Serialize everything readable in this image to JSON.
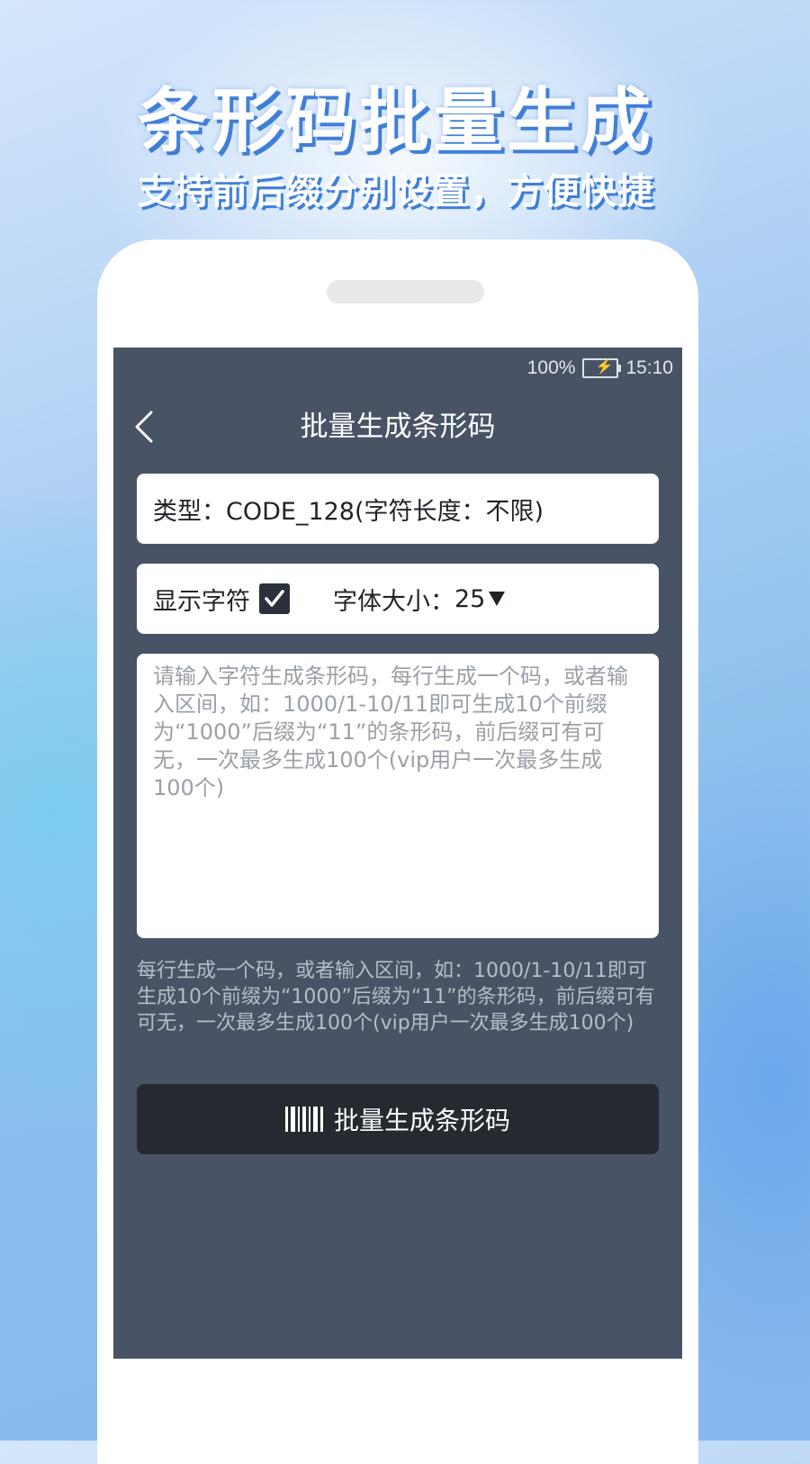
{
  "promo": {
    "title": "条形码批量生成",
    "subtitle": "支持前后缀分别设置，方便快捷"
  },
  "status_bar": {
    "battery_percent": "100%",
    "battery_level": 1.0,
    "battery_icon": "battery-charging-icon",
    "time": "15:10"
  },
  "nav": {
    "back_icon": "chevron-left-icon",
    "title": "批量生成条形码"
  },
  "type_card": {
    "text": "类型：CODE_128(字符长度：不限)"
  },
  "options": {
    "show_chars_label": "显示字符",
    "show_chars_checked": true,
    "font_size_label": "字体大小：",
    "font_size_value": "25"
  },
  "input": {
    "value": "",
    "placeholder": "请输入字符生成条形码，每行生成一个码，或者输入区间，如：1000/1-10/11即可生成10个前缀为“1000”后缀为“11”的条形码，前后缀可有可无，一次最多生成100个(vip用户一次最多生成100个)"
  },
  "hint": {
    "text": "每行生成一个码，或者输入区间，如：1000/1-10/11即可生成10个前缀为“1000”后缀为“11”的条形码，前后缀可有可无，一次最多生成100个(vip用户一次最多生成100个)"
  },
  "generate_button": {
    "icon": "barcode-icon",
    "label": "批量生成条形码"
  },
  "colors": {
    "screen_bg": "#485465",
    "button_bg": "#252a31",
    "card_bg": "#ffffff",
    "accent_shadow": "#3f7fd8",
    "battery_green": "#5cc93a"
  }
}
